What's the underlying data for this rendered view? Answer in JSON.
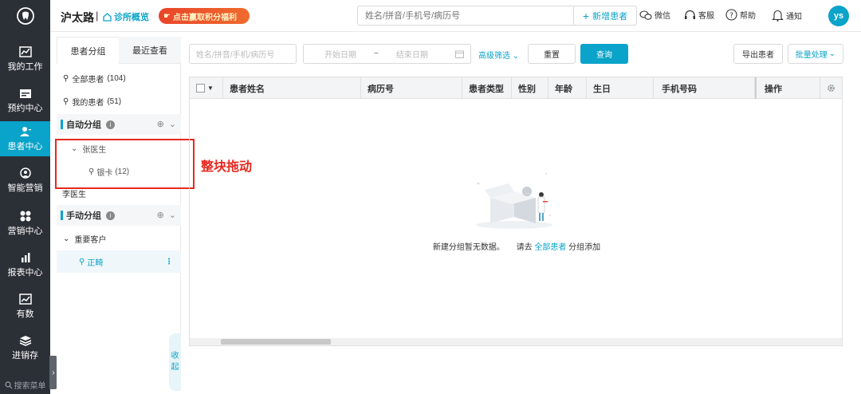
{
  "nav": {
    "items": [
      {
        "label": "我的工作",
        "icon": "chart-icon"
      },
      {
        "label": "预约中心",
        "icon": "calendar-icon"
      },
      {
        "label": "患者中心",
        "icon": "user-icon"
      },
      {
        "label": "智能营销",
        "icon": "marketing-icon"
      },
      {
        "label": "营销中心",
        "icon": "grid-icon"
      },
      {
        "label": "报表中心",
        "icon": "bar-chart-icon"
      },
      {
        "label": "有数",
        "icon": "trend-icon"
      },
      {
        "label": "进销存",
        "icon": "stack-icon"
      }
    ],
    "active_index": 2,
    "search_menu": "搜索菜单",
    "expand_glyph": "›"
  },
  "topbar": {
    "clinic": "沪太路",
    "separator": "|",
    "overview": "诊所概览",
    "promo": "点击赢取积分福利",
    "search_placeholder": "姓名/拼音/手机号/病历号",
    "new_patient": "新增患者",
    "wechat": "微信",
    "service": "客服",
    "help": "帮助",
    "notify": "通知",
    "avatar": "ys"
  },
  "groups": {
    "tabs": [
      "患者分组",
      "最近查看"
    ],
    "all_patients": "全部患者",
    "all_count": "(104)",
    "my_patients": "我的患者",
    "my_count": "(51)",
    "auto_group": "自动分组",
    "doctor_zhang": "张医生",
    "silver_card": "银卡",
    "silver_count": "(12)",
    "doctor_li": "李医生",
    "manual_group": "手动分组",
    "vip": "重要客户",
    "zhengqi": "正畸",
    "collapse": "收起",
    "drag_annotation": "整块拖动"
  },
  "filter": {
    "name_placeholder": "姓名/拼音/手机/病历号",
    "start_date": "开始日期",
    "tilde": "~",
    "end_date": "结束日期",
    "advanced": "高级筛选",
    "reset": "重置",
    "query": "查询",
    "export": "导出患者",
    "batch": "批量处理"
  },
  "table": {
    "headers": [
      "患者姓名",
      "病历号",
      "患者类型",
      "性别",
      "年龄",
      "生日",
      "手机号码",
      "操作"
    ],
    "empty_text_1": "新建分组暂无数据。",
    "empty_text_2": "请去",
    "empty_link": "全部患者",
    "empty_text_3": "分组添加"
  },
  "colors": {
    "accent": "#0aa3c9",
    "nav_bg": "#2b2f36",
    "annotation": "#e8281e"
  }
}
